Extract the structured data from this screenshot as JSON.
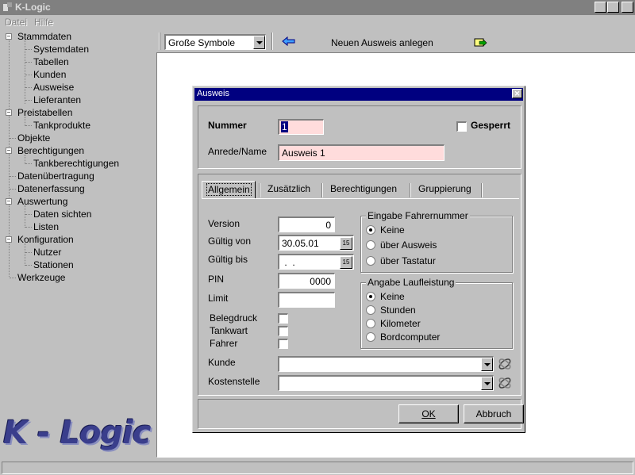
{
  "window": {
    "title": "K-Logic"
  },
  "menu": [
    "Datei",
    "Hilfe"
  ],
  "tree": {
    "stammdaten": "Stammdaten",
    "systemdaten": "Systemdaten",
    "tabellen": "Tabellen",
    "kunden": "Kunden",
    "ausweise": "Ausweise",
    "lieferanten": "Lieferanten",
    "preistabellen": "Preistabellen",
    "tankprodukte": "Tankprodukte",
    "objekte": "Objekte",
    "berechtigungen": "Berechtigungen",
    "tankberechtigungen": "Tankberechtigungen",
    "datenuebertragung": "Datenübertragung",
    "datenerfassung": "Datenerfassung",
    "auswertung": "Auswertung",
    "daten_sichten": "Daten sichten",
    "listen": "Listen",
    "konfiguration": "Konfiguration",
    "nutzer": "Nutzer",
    "stationen": "Stationen",
    "werkzeuge": "Werkzeuge"
  },
  "logo": {
    "text": "K - Logic"
  },
  "toolbar": {
    "view_select": "Große Symbole",
    "new_label": "Neuen Ausweis anlegen"
  },
  "dialog": {
    "title": "Ausweis",
    "nummer_label": "Nummer",
    "nummer_value": "1",
    "gesperrt_label": "Gesperrt",
    "anrede_label": "Anrede/Name",
    "anrede_value": "Ausweis 1",
    "tabs": [
      "Allgemein",
      "Zusätzlich",
      "Berechtigungen",
      "Gruppierung"
    ],
    "version_label": "Version",
    "version_value": "0",
    "gueltig_von_label": "Gültig von",
    "gueltig_von_value": "30.05.01",
    "gueltig_bis_label": "Gültig bis",
    "gueltig_bis_value": " .  .",
    "pin_label": "PIN",
    "pin_value": "0000",
    "limit_label": "Limit",
    "limit_value": "",
    "belegdruck_label": "Belegdruck",
    "tankwart_label": "Tankwart",
    "fahrer_label": "Fahrer",
    "kunde_label": "Kunde",
    "kostenstelle_label": "Kostenstelle",
    "calendar_button": "15",
    "group_fahrer": {
      "title": "Eingabe Fahrernummer",
      "options": [
        "Keine",
        "über Ausweis",
        "über Tastatur"
      ],
      "selected": "Keine"
    },
    "group_lauf": {
      "title": "Angabe Laufleistung",
      "options": [
        "Keine",
        "Stunden",
        "Kilometer",
        "Bordcomputer"
      ],
      "selected": "Keine"
    },
    "ok_label": "OK",
    "abbruch_label": "Abbruch"
  }
}
